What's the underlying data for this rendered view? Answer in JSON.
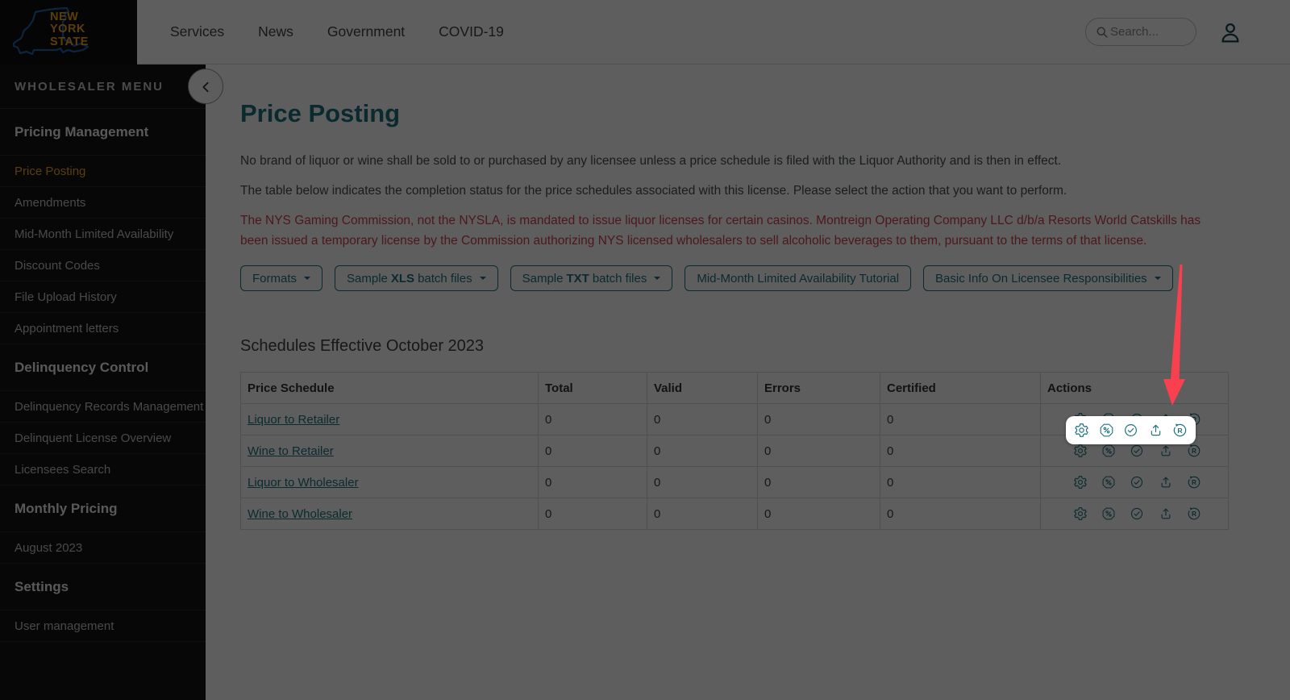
{
  "header": {
    "logo": {
      "line1": "NEW",
      "line2": "YORK",
      "line3": "STATE"
    },
    "nav": [
      {
        "label": "Services"
      },
      {
        "label": "News"
      },
      {
        "label": "Government"
      },
      {
        "label": "COVID-19"
      }
    ],
    "search_placeholder": "Search..."
  },
  "sidebar": {
    "title": "WHOLESALER MENU",
    "active_item": "Price Posting",
    "sections": [
      {
        "header": "Pricing Management",
        "items": [
          "Price Posting",
          "Amendments",
          "Mid-Month Limited Availability",
          "Discount Codes",
          "File Upload History",
          "Appointment letters"
        ]
      },
      {
        "header": "Delinquency Control",
        "items": [
          "Delinquency Records Management",
          "Delinquent License Overview",
          "Licensees Search"
        ]
      },
      {
        "header": "Monthly Pricing",
        "items": [
          "August 2023"
        ]
      },
      {
        "header": "Settings",
        "items": [
          "User management"
        ]
      }
    ]
  },
  "main": {
    "title": "Price Posting",
    "paragraph1": "No brand of liquor or wine shall be sold to or purchased by any licensee unless a price schedule is filed with the Liquor Authority and is then in effect.",
    "paragraph2": "The table below indicates the completion status for the price schedules associated with this license. Please select the action that you want to perform.",
    "notice": "The NYS Gaming Commission, not the NYSLA, is mandated to issue liquor licenses for certain casinos. Montreign Operating Company LLC d/b/a Resorts World Catskills has been issued a temporary license by the Commission authorizing NYS licensed wholesalers to sell alcoholic beverages to them, pursuant to the terms of that license.",
    "buttons": [
      {
        "pre": "Formats",
        "bold": "",
        "post": ""
      },
      {
        "pre": "Sample",
        "bold": "XLS",
        "post": "batch files"
      },
      {
        "pre": "Sample",
        "bold": "TXT",
        "post": "batch files"
      },
      {
        "pre": "Mid-Month Limited Availability Tutorial",
        "bold": "",
        "post": ""
      },
      {
        "pre": "Basic Info On Licensee Responsibilities",
        "bold": "",
        "post": ""
      }
    ],
    "table": {
      "section_title": "Schedules Effective October 2023",
      "headers": [
        "Price Schedule",
        "Total",
        "Valid",
        "Errors",
        "Certified",
        "Actions"
      ],
      "action_icons": [
        "gear",
        "percent-badge",
        "check-circle",
        "upload",
        "rollover-r"
      ],
      "rows": [
        {
          "schedule": "Liquor to Retailer",
          "total": "0",
          "valid": "0",
          "errors": "0",
          "certified": "0"
        },
        {
          "schedule": "Wine to Retailer",
          "total": "0",
          "valid": "0",
          "errors": "0",
          "certified": "0"
        },
        {
          "schedule": "Liquor to Wholesaler",
          "total": "0",
          "valid": "0",
          "errors": "0",
          "certified": "0"
        },
        {
          "schedule": "Wine to Wholesaler",
          "total": "0",
          "valid": "0",
          "errors": "0",
          "certified": "0"
        }
      ]
    }
  },
  "annotation": {
    "highlight_target": "first-row-actions",
    "arrow_color": "#f8404f",
    "colors": {
      "accent_teal": "#1f7380",
      "error_red": "#cf3f4c",
      "active_gold": "#f5a623"
    }
  }
}
